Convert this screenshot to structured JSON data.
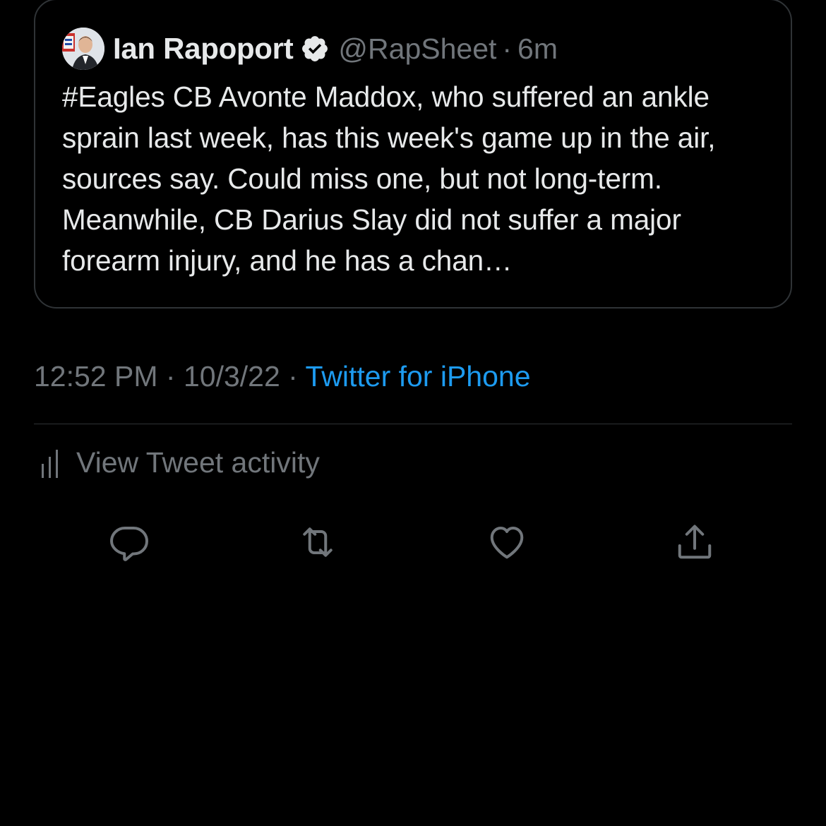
{
  "quoted_tweet": {
    "author_name": "Ian Rapoport",
    "handle": "@RapSheet",
    "separator": "·",
    "time_ago": "6m",
    "text": "#Eagles CB Avonte Maddox, who suffered an ankle sprain last week, has this week's game up in the air, sources say. Could miss one, but not long-term.  Meanwhile, CB Darius Slay did not suffer a major forearm injury, and he has a chan…"
  },
  "meta": {
    "time": "12:52 PM",
    "separator": "·",
    "date": "10/3/22",
    "source": "Twitter for iPhone"
  },
  "activity": {
    "label": "View Tweet activity",
    "icon": "bar-chart-icon"
  },
  "actions": [
    {
      "name": "reply",
      "icon": "reply-icon"
    },
    {
      "name": "retweet",
      "icon": "retweet-icon"
    },
    {
      "name": "like",
      "icon": "heart-icon"
    },
    {
      "name": "share",
      "icon": "share-icon"
    }
  ],
  "colors": {
    "background": "#000000",
    "text": "#e7e9ea",
    "secondary_text": "#71767b",
    "link": "#1d9bf0",
    "border": "#2f3336"
  }
}
